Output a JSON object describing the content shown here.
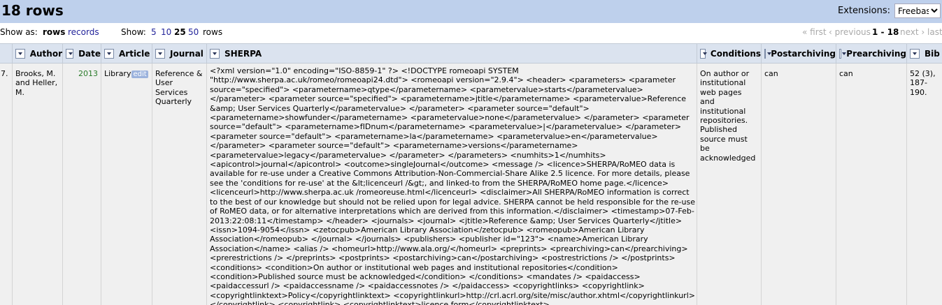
{
  "header": {
    "title": "18 rows",
    "extensions_label": "Extensions:",
    "extensions_value": "Freebase"
  },
  "options": {
    "show_as": "Show as:",
    "rows": "rows",
    "records": "records",
    "show": "Show:",
    "sizes": [
      "5",
      "10",
      "25",
      "50"
    ],
    "sizes_suffix": "rows",
    "first": "« first",
    "previous": "‹ previous",
    "range": "1 - 18",
    "next": "next ›",
    "last": "last"
  },
  "columns": [
    "Author",
    "Date",
    "Article",
    "Journal",
    "SHERPA",
    "Conditions",
    "Postarchiving",
    "Prearchiving",
    "Bib"
  ],
  "row": {
    "num": "7.",
    "author": "Brooks, M. and Heller, M.",
    "date": "2013",
    "article": "Library",
    "edit": "edit",
    "journal": "Reference & User Services Quarterly",
    "sherpa": "<?xml version=\"1.0\" encoding=\"ISO-8859-1\" ?> <!DOCTYPE romeoapi SYSTEM \"http://www.sherpa.ac.uk/romeo/romeoapi24.dtd\"> <romeoapi version=\"2.9.4\"> <header> <parameters> <parameter source=\"specified\"> <parametername>qtype</parametername> <parametervalue>starts</parametervalue> </parameter> <parameter source=\"specified\"> <parametername>jtitle</parametername> <parametervalue>Reference &amp; User Services Quarterly</parametervalue> </parameter> <parameter source=\"default\"> <parametername>showfunder</parametername> <parametervalue>none</parametervalue> </parameter> <parameter source=\"default\"> <parametername>fIDnum</parametername> <parametervalue>|</parametervalue> </parameter> <parameter source=\"default\"> <parametername>la</parametername> <parametervalue>en</parametervalue> </parameter> <parameter source=\"default\"> <parametername>versions</parametername> <parametervalue>legacy</parametervalue> </parameter> </parameters> <numhits>1</numhits> <apicontrol>journal</apicontrol> <outcome>singleJournal</outcome> <message /> <licence>SHERPA/RoMEO data is available for re-use under a Creative Commons Attribution-Non-Commercial-Share Alike 2.5 licence. For more details, please see the 'conditions for re-use' at the &lt;licenceurl /&gt;, and linked-to from the SHERPA/RoMEO home page.</licence> <licenceurl>http://www.sherpa.ac.uk /romeoreuse.html</licenceurl> <disclaimer>All SHERPA/RoMEO information is correct to the best of our knowledge but should not be relied upon for legal advice. SHERPA cannot be held responsible for the re-use of RoMEO data, or for alternative interpretations which are derived from this information.</disclaimer> <timestamp>07-Feb-2013:22:08:11</timestamp> </header> <journals> <journal> <jtitle>Reference &amp; User Services Quarterly</jtitle> <issn>1094-9054</issn> <zetocpub>American Library Association</zetocpub> <romeopub>American Library Association</romeopub> </journal> </journals> <publishers> <publisher id=\"123\"> <name>American Library Association</name> <alias /> <homeurl>http://www.ala.org/</homeurl> <preprints> <prearchiving>can</prearchiving> <prerestrictions /> </preprints> <postprints> <postarchiving>can</postarchiving> <postrestrictions /> </postprints> <conditions> <condition>On author or institutional web pages and institutional repositories</condition> <condition>Published source must be acknowledged</condition> </conditions> <mandates /> <paidaccess> <paidaccessurl /> <paidaccessname /> <paidaccessnotes /> </paidaccess> <copyrightlinks> <copyrightlink> <copyrightlinktext>Policy</copyrightlinktext> <copyrightlinkurl>http://crl.acrl.org/site/misc/author.xhtml</copyrightlinkurl> </copyrightlink> <copyrightlink> <copyrightlinktext>licence form</copyrightlinktext> <copyrightlinkurl>http://www.ala.org/acrl/sites/ala.org.acrl/files/content /resources/forms/C&amp;RLAuthorAgreement.pdf</copyrightlinkurl> </copyrightlink> <copyrightlink> <copyrightlinktext>ACRL FAQs</copyrightlinktext> <copyrightlinkurl>http://www.ala.org/acrl/publications/publicationsfaq</copyrightlinkurl> </copyrightlink> </copyrightlinks> <romeocolour>green</romeocolour> <dateadded>2005-11-02 00:00:00</dateadded> <dateupdated>2009-09-01 11:53:30</dateupdated> </publisher> </publishers> </romeoapi>",
    "conditions": "On author or institutional web pages and institutional repositories. Published source must be acknowledged",
    "postarchiving": "can",
    "prearchiving": "can",
    "bib": "52 (3), 187-190."
  }
}
